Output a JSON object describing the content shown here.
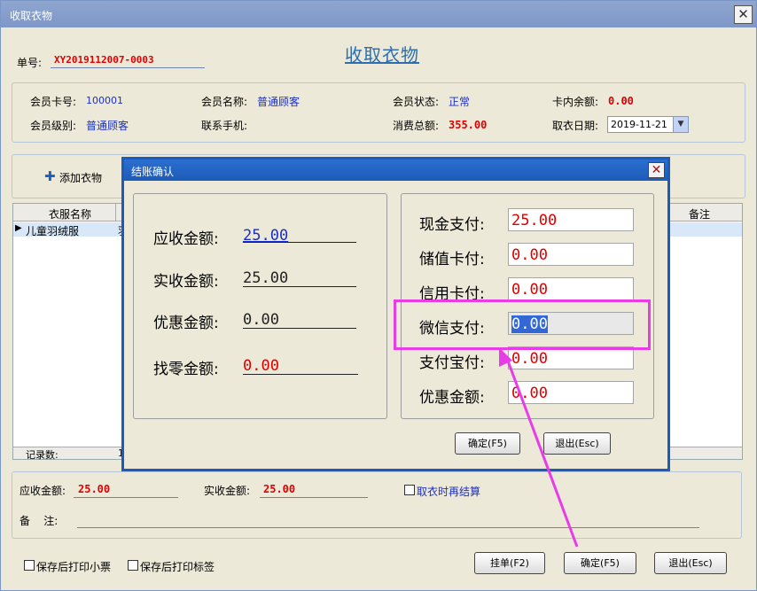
{
  "window": {
    "title": "收取衣物",
    "close_icon": "close-icon"
  },
  "header": {
    "order_no_label": "单号:",
    "order_no": "XY2019112007-0003",
    "page_title": "收取衣物"
  },
  "member": {
    "card_no_label": "会员卡号:",
    "card_no": "100001",
    "name_label": "会员名称:",
    "name": "普通顾客",
    "status_label": "会员状态:",
    "status": "正常",
    "balance_label": "卡内余额:",
    "balance": "0.00",
    "level_label": "会员级别:",
    "level": "普通顾客",
    "phone_label": "联系手机:",
    "phone": "",
    "total_label": "消费总额:",
    "total": "355.00",
    "pickup_date_label": "取衣日期:",
    "pickup_date": "2019-11-21"
  },
  "toolbar": {
    "add_label": "添加衣物"
  },
  "grid": {
    "columns": [
      "衣服名称",
      "备注"
    ],
    "rows": [
      {
        "name": "儿童羽绒服",
        "cut": "羽"
      }
    ],
    "footer_label": "记录数:",
    "footer_value": "1"
  },
  "summary": {
    "receivable_label": "应收金额:",
    "receivable": "25.00",
    "received_label": "实收金额:",
    "received": "25.00",
    "settle_on_pickup_label": "取衣时再结算",
    "remark_label": "备    注:"
  },
  "bottom": {
    "print_receipt_label": "保存后打印小票",
    "print_tag_label": "保存后打印标签",
    "hold_button": "挂单(F2)",
    "confirm_button": "确定(F5)",
    "exit_button": "退出(Esc)"
  },
  "dialog": {
    "title": "结账确认",
    "left": [
      {
        "label": "应收金额:",
        "value": "25.00"
      },
      {
        "label": "实收金额:",
        "value": "25.00"
      },
      {
        "label": "优惠金额:",
        "value": "0.00"
      },
      {
        "label": "找零金额:",
        "value": "0.00"
      }
    ],
    "right": [
      {
        "label": "现金支付:",
        "value": "25.00"
      },
      {
        "label": "储值卡付:",
        "value": "0.00"
      },
      {
        "label": "信用卡付:",
        "value": "0.00"
      },
      {
        "label": "微信支付:",
        "value": "0.00"
      },
      {
        "label": "支付宝付:",
        "value": "0.00"
      },
      {
        "label": "优惠金额:",
        "value": "0.00"
      }
    ],
    "confirm_button": "确定(F5)",
    "exit_button": "退出(Esc)"
  },
  "colors": {
    "annotation": "#e83ce6",
    "accent": "#1d5bb8",
    "value_red": "#e00000",
    "value_blue": "#1a2fc9"
  }
}
